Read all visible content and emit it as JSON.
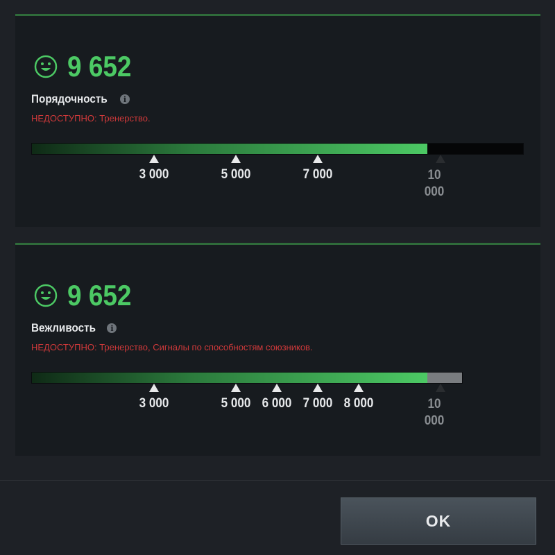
{
  "panels": [
    {
      "score": "9 652",
      "title": "Порядочность",
      "info": "i",
      "unavailable_label": "НЕДОСТУПНО:",
      "unavailable_reasons": "Тренерство.",
      "progress": 0.9652,
      "ticks": [
        "3 000",
        "5 000",
        "7 000"
      ],
      "max_label_line1": "10",
      "max_label_line2": "000"
    },
    {
      "score": "9 652",
      "title": "Вежливость",
      "info": "i",
      "unavailable_label": "НЕДОСТУПНО:",
      "unavailable_reasons": "Тренерство, Сигналы по способностям союзников.",
      "progress": 0.9652,
      "ticks": [
        "3 000",
        "5 000",
        "6 000",
        "7 000",
        "8 000"
      ],
      "max_label_line1": "10",
      "max_label_line2": "000"
    }
  ],
  "ok_label": "OK",
  "colors": {
    "accent_green": "#4cc964",
    "warning_red": "#d0393a",
    "panel_bg": "#171b1f",
    "page_bg": "#1e2126"
  },
  "icons": {
    "score": "smiley-icon",
    "info": "info-icon",
    "tick": "triangle-marker-icon"
  }
}
